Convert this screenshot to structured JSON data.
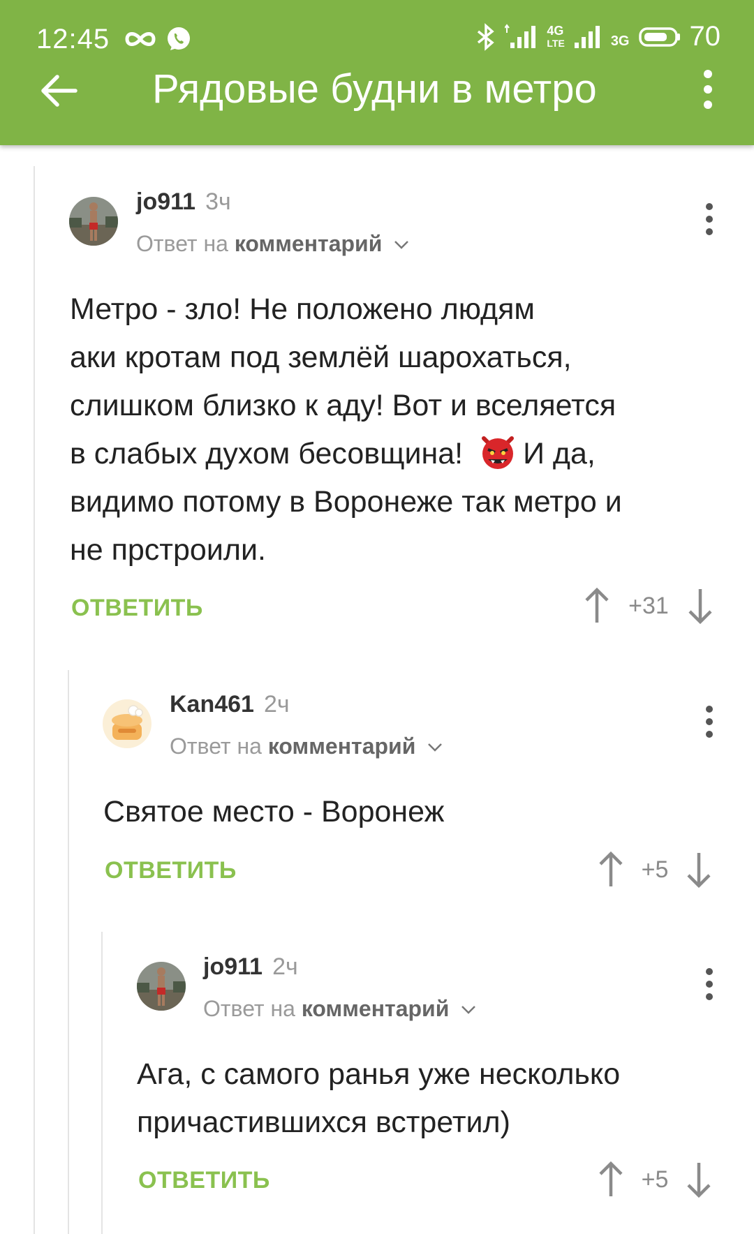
{
  "status_bar": {
    "time": "12:45",
    "network_4g": "4G",
    "network_lte": "LTE",
    "network_3g": "3G",
    "battery": "70"
  },
  "toolbar": {
    "title": "Рядовые будни в метро"
  },
  "comments": [
    {
      "author": "jo911",
      "ago": "3ч",
      "reply_prefix": "Ответ на",
      "reply_target": "комментарий",
      "lines": [
        "Метро - зло! Не положено людям",
        "аки кротам под землёй шарохаться,",
        "слишком близко к аду! Вот и вселяется",
        "в слабых духом бесовщина!",
        "И да,",
        "видимо потому в Воронеже так метро и",
        "не прстроили."
      ],
      "reply_label": "ОТВЕТИТЬ",
      "score": "+31"
    },
    {
      "author": "Kan461",
      "ago": "2ч",
      "reply_prefix": "Ответ на",
      "reply_target": "комментарий",
      "lines": [
        "Святое место - Воронеж"
      ],
      "reply_label": "ОТВЕТИТЬ",
      "score": "+5"
    },
    {
      "author": "jo911",
      "ago": "2ч",
      "reply_prefix": "Ответ на",
      "reply_target": "комментарий",
      "lines": [
        "Ага, с самого ранья уже несколько",
        "причастившихся встретил)"
      ],
      "reply_label": "ОТВЕТИТЬ",
      "score": "+5"
    }
  ],
  "colors": {
    "brand": "#80b446",
    "reply": "#8ac14f"
  }
}
